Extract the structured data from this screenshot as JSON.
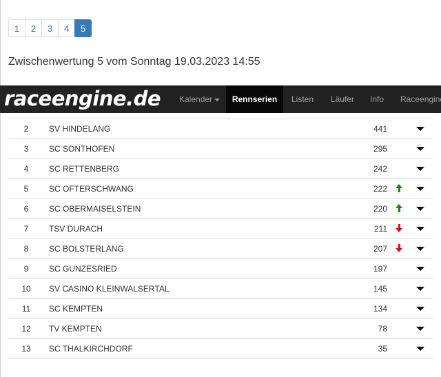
{
  "pagination": {
    "pages": [
      "1",
      "2",
      "3",
      "4",
      "5"
    ],
    "active_index": 4
  },
  "heading": "Zwischenwertung 5 vom Sonntag 19.03.2023 14:55",
  "navbar": {
    "brand": "raceengine.de",
    "items": [
      {
        "label": "Kalender",
        "dropdown": true,
        "active": false
      },
      {
        "label": "Rennserien",
        "dropdown": false,
        "active": true
      },
      {
        "label": "Listen",
        "dropdown": false,
        "active": false
      },
      {
        "label": "Läufer",
        "dropdown": false,
        "active": false
      },
      {
        "label": "Info",
        "dropdown": false,
        "active": false
      },
      {
        "label": "Raceengine",
        "dropdown": false,
        "active": false
      }
    ]
  },
  "colors": {
    "link": "#337ab7",
    "navbar_bg": "#222222",
    "up": "#0b8a0b",
    "down": "#e01010"
  },
  "standings": [
    {
      "rank": "2",
      "club": "SV HINDELANG",
      "points": "441",
      "trend": "none"
    },
    {
      "rank": "3",
      "club": "SC SONTHOFEN",
      "points": "295",
      "trend": "none"
    },
    {
      "rank": "4",
      "club": "SC RETTENBERG",
      "points": "242",
      "trend": "none"
    },
    {
      "rank": "5",
      "club": "SC OFTERSCHWANG",
      "points": "222",
      "trend": "up"
    },
    {
      "rank": "6",
      "club": "SC OBERMAISELSTEIN",
      "points": "220",
      "trend": "up"
    },
    {
      "rank": "7",
      "club": "TSV DURACH",
      "points": "211",
      "trend": "down"
    },
    {
      "rank": "8",
      "club": "SC BOLSTERLANG",
      "points": "207",
      "trend": "down"
    },
    {
      "rank": "9",
      "club": "SC GUNZESRIED",
      "points": "197",
      "trend": "none"
    },
    {
      "rank": "10",
      "club": "SV CASINO KLEINWALSERTAL",
      "points": "145",
      "trend": "none"
    },
    {
      "rank": "11",
      "club": "SC KEMPTEN",
      "points": "134",
      "trend": "none"
    },
    {
      "rank": "12",
      "club": "TV KEMPTEN",
      "points": "78",
      "trend": "none"
    },
    {
      "rank": "13",
      "club": "SC THALKIRCHDORF",
      "points": "35",
      "trend": "none"
    }
  ]
}
